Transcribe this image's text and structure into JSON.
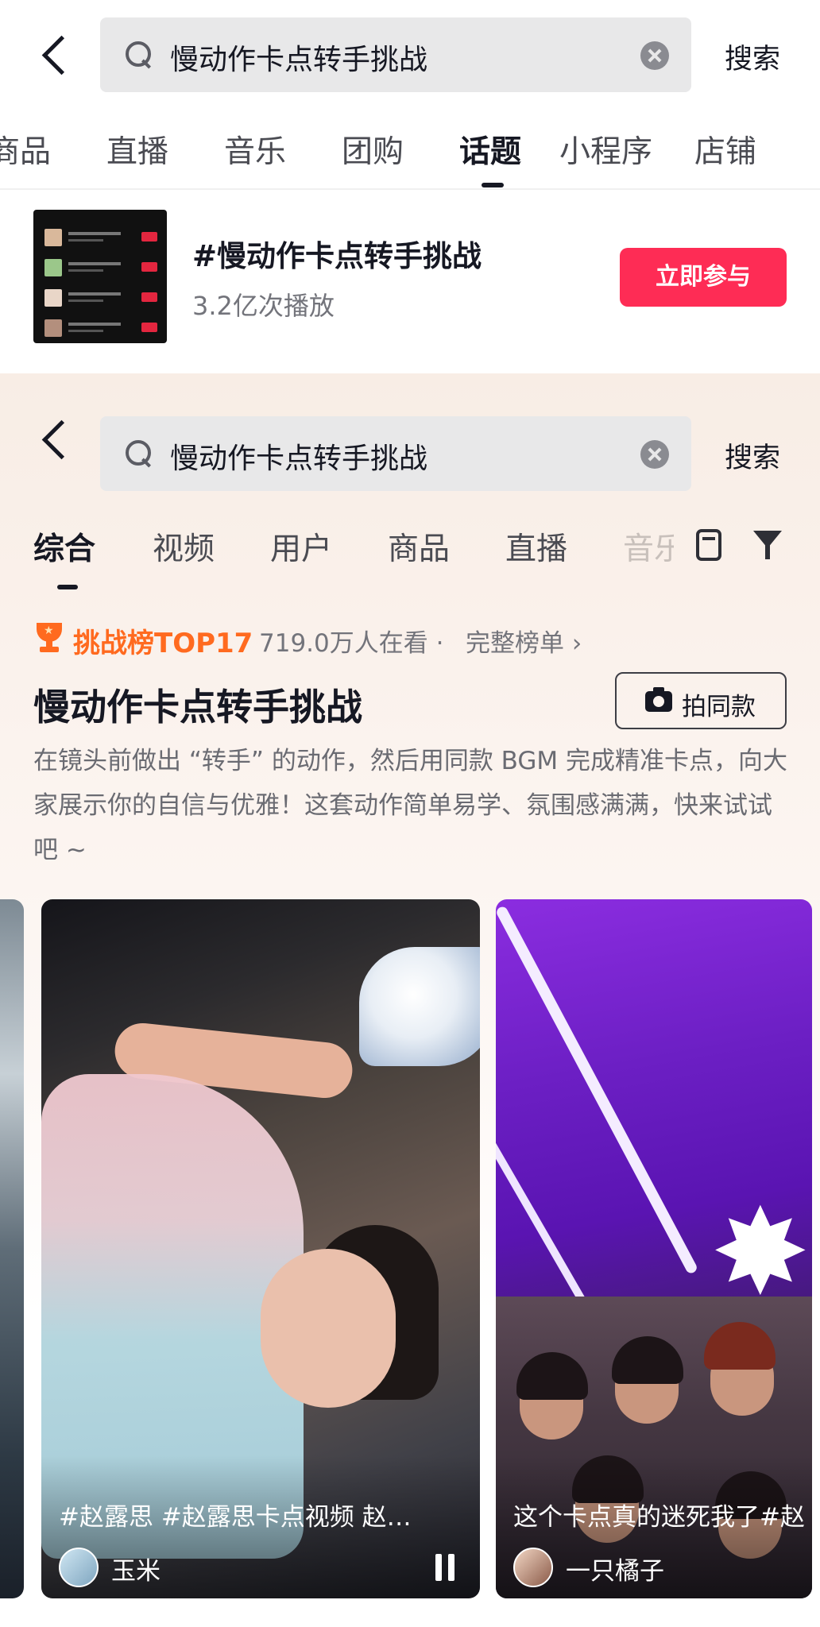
{
  "top": {
    "search": {
      "query": "慢动作卡点转手挑战",
      "button_label": "搜索"
    },
    "tabs": [
      {
        "label": "商品",
        "active": false
      },
      {
        "label": "直播",
        "active": false
      },
      {
        "label": "音乐",
        "active": false
      },
      {
        "label": "团购",
        "active": false
      },
      {
        "label": "话题",
        "active": true
      },
      {
        "label": "小程序",
        "active": false
      },
      {
        "label": "店铺",
        "active": false
      }
    ],
    "topic": {
      "title": "#慢动作卡点转手挑战",
      "plays": "3.2亿次播放",
      "join_label": "立即参与"
    }
  },
  "bottom": {
    "search": {
      "query": "慢动作卡点转手挑战",
      "button_label": "搜索"
    },
    "tabs": [
      {
        "label": "综合",
        "active": true
      },
      {
        "label": "视频",
        "active": false
      },
      {
        "label": "用户",
        "active": false
      },
      {
        "label": "商品",
        "active": false
      },
      {
        "label": "直播",
        "active": false
      },
      {
        "label": "音乐",
        "active": false
      }
    ],
    "challenge": {
      "rank_label": "挑战榜TOP17",
      "viewers": "719.0万人在看 · ",
      "full_list": "完整榜单 ›",
      "title": "慢动作卡点转手挑战",
      "shoot_label": "拍同款",
      "description": "在镜头前做出 “转手” 的动作，然后用同款 BGM 完成精准卡点，向大家展示你的自信与优雅！这套动作简单易学、氛围感满满，快来试试吧 ~"
    },
    "videos": [
      {
        "caption": "#赵露思 #赵露思卡点视频  赵…",
        "author": "玉米"
      },
      {
        "caption": "这个卡点真的迷死我了#赵",
        "author": "一只橘子"
      }
    ]
  },
  "colors": {
    "accent": "#fe2c55",
    "rank_orange": "#ff6a1f",
    "text_primary": "#161823",
    "text_secondary": "#73747b"
  },
  "icons": [
    "back-icon",
    "search-icon",
    "clear-icon",
    "trophy-icon",
    "camera-icon",
    "document-icon",
    "filter-icon",
    "pause-icon"
  ]
}
